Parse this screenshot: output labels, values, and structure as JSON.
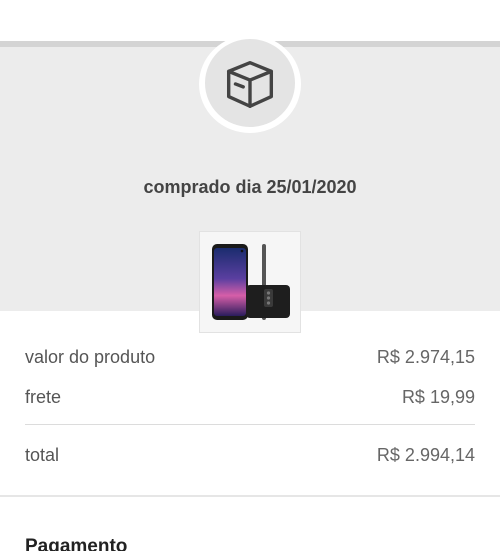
{
  "order": {
    "purchase_date_text": "comprado dia 25/01/2020",
    "box_icon": "package-box-icon",
    "product_image": "smartphone-product-thumbnail"
  },
  "summary": {
    "product_label": "valor do produto",
    "product_value": "R$ 2.974,15",
    "shipping_label": "frete",
    "shipping_value": "R$ 19,99",
    "total_label": "total",
    "total_value": "R$ 2.994,14"
  },
  "payment": {
    "title": "Pagamento"
  },
  "colors": {
    "panel_bg": "#ececec",
    "divider": "#d4d4d4",
    "text": "#555555"
  }
}
